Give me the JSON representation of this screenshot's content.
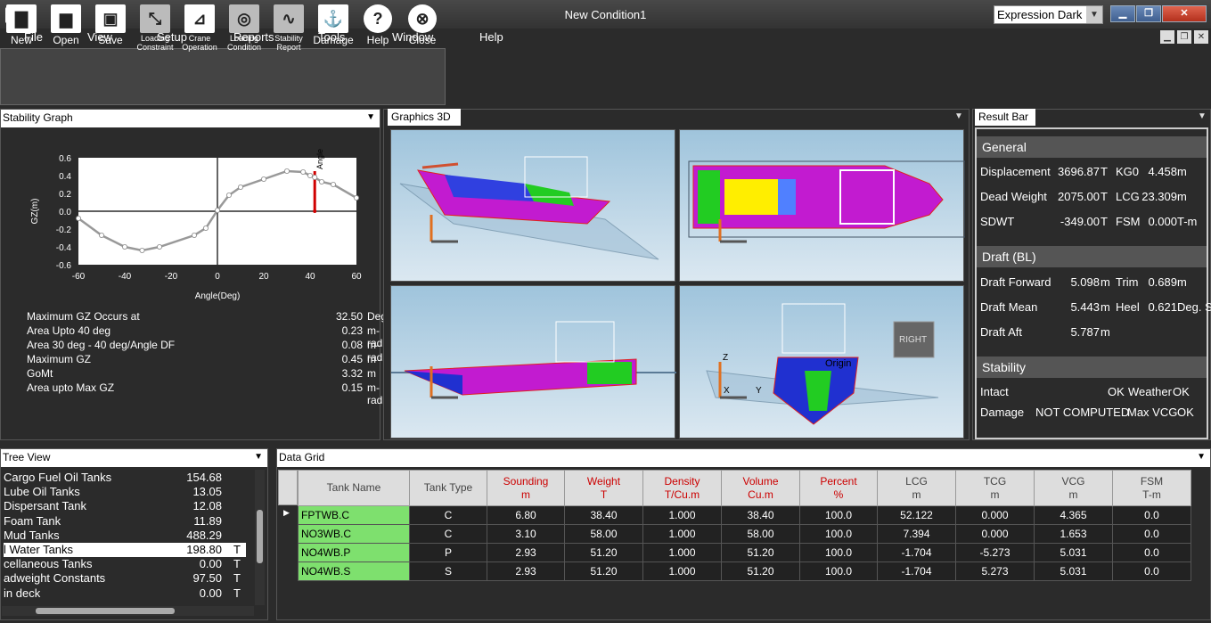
{
  "title": "New Condition1",
  "theme": "Expression Dark",
  "window_buttons": {
    "minimize": "▁",
    "restore": "❐",
    "close": "✕"
  },
  "menu": [
    "File",
    "View",
    "Setup",
    "Reports",
    "Tools",
    "Window",
    "Help"
  ],
  "toolbar": [
    {
      "label": "New",
      "icon": "new-icon"
    },
    {
      "label": "Open",
      "icon": "open-folder-icon"
    },
    {
      "label": "Save",
      "icon": "save-icon"
    },
    {
      "label": "Loading Constraint",
      "icon": "loading-constraint-icon"
    },
    {
      "label": "Crane Operation",
      "icon": "crane-icon"
    },
    {
      "label": "Loading Condition",
      "icon": "loading-condition-icon"
    },
    {
      "label": "Stability Report",
      "icon": "stability-report-icon"
    },
    {
      "label": "Damage",
      "icon": "damage-icon"
    },
    {
      "label": "Help",
      "icon": "help-icon"
    },
    {
      "label": "Close",
      "icon": "close-icon"
    }
  ],
  "stability_graph": {
    "header": "Stability Graph",
    "stats": [
      {
        "label": "Maximum GZ Occurs at",
        "value": "32.50",
        "unit": "Deg"
      },
      {
        "label": "Area Upto 40 deg",
        "value": "0.23",
        "unit": "m-rad"
      },
      {
        "label": "Area 30 deg - 40 deg/Angle DF",
        "value": "0.08",
        "unit": "m-rad"
      },
      {
        "label": "Maximum GZ",
        "value": "0.45",
        "unit": "m"
      },
      {
        "label": "GoMt",
        "value": "3.32",
        "unit": "m"
      },
      {
        "label": "Area upto Max GZ",
        "value": "0.15",
        "unit": "m-rad"
      }
    ]
  },
  "chart_data": {
    "type": "line",
    "xlabel": "Angle(Deg)",
    "ylabel": "GZ(m)",
    "xlim": [
      -60,
      60
    ],
    "ylim": [
      -0.6,
      0.6
    ],
    "xticks": [
      "-60",
      "-40",
      "-20",
      "0",
      "20",
      "40",
      "60"
    ],
    "yticks": [
      "0.6",
      "0.4",
      "0.2",
      "0.0",
      "-0.2",
      "-0.4",
      "-0.6"
    ],
    "x": [
      -60,
      -50,
      -40,
      -32.5,
      -25,
      -10,
      -5,
      0,
      5,
      10,
      20,
      30,
      37,
      40,
      42,
      45,
      50,
      60
    ],
    "y": [
      -0.08,
      -0.27,
      -0.4,
      -0.44,
      -0.4,
      -0.27,
      -0.19,
      0.01,
      0.18,
      0.27,
      0.36,
      0.45,
      0.44,
      0.4,
      0.38,
      0.33,
      0.3,
      0.15
    ],
    "annotation": {
      "label": "Angle DF",
      "x": 42,
      "y_from": 0.0,
      "y_to": 0.45
    }
  },
  "graphics3d": {
    "header": "Graphics 3D",
    "right_label": "RIGHT",
    "origin_label": "Origin",
    "axis_z": "Z",
    "axis_y": "Y",
    "axis_x": "X"
  },
  "result_bar": {
    "header": "Result Bar",
    "general": {
      "title": "General",
      "rows": [
        [
          "Displacement",
          "3696.87",
          "T",
          "KG0",
          "4.458",
          "m"
        ],
        [
          "Dead Weight",
          "2075.00",
          "T",
          "LCG",
          "23.309",
          "m"
        ],
        [
          "SDWT",
          "-349.00",
          "T",
          "FSM",
          "0.000",
          "T-m"
        ]
      ]
    },
    "draft": {
      "title": "Draft (BL)",
      "rows": [
        [
          "Draft Forward",
          "5.098",
          "m",
          "Trim",
          "0.689",
          "m"
        ],
        [
          "Draft Mean",
          "5.443",
          "m",
          "Heel",
          "0.621",
          "Deg. S"
        ],
        [
          "Draft Aft",
          "5.787",
          "m",
          "",
          "",
          ""
        ]
      ]
    },
    "stability": {
      "title": "Stability",
      "intact_label": "Intact",
      "intact_value": "OK",
      "weather_label": "Weather",
      "weather_value": "OK",
      "damage_label": "Damage",
      "damage_value": "NOT COMPUTED",
      "maxvcg_label": "Max VCG",
      "maxvcg_value": "OK"
    }
  },
  "tree_view": {
    "header": "Tree View",
    "items": [
      {
        "label": "Cargo Fuel Oil Tanks",
        "value": "154.68",
        "unit": ""
      },
      {
        "label": "Lube Oil Tanks",
        "value": "13.05",
        "unit": ""
      },
      {
        "label": "Dispersant Tank",
        "value": "12.08",
        "unit": ""
      },
      {
        "label": "Foam Tank",
        "value": "11.89",
        "unit": ""
      },
      {
        "label": "Mud Tanks",
        "value": "488.29",
        "unit": ""
      },
      {
        "label": "l Water Tanks",
        "value": "198.80",
        "unit": "T"
      },
      {
        "label": "cellaneous Tanks",
        "value": "0.00",
        "unit": "T"
      },
      {
        "label": "adweight Constants",
        "value": "97.50",
        "unit": "T"
      },
      {
        "label": "in deck",
        "value": "0.00",
        "unit": "T"
      }
    ],
    "selected_index": 5
  },
  "data_grid": {
    "header": "Data Grid",
    "columns": [
      {
        "l1": "Tank Name",
        "l2": "",
        "red": false
      },
      {
        "l1": "Tank Type",
        "l2": "",
        "red": false
      },
      {
        "l1": "Sounding",
        "l2": "m",
        "red": true
      },
      {
        "l1": "Weight",
        "l2": "T",
        "red": true
      },
      {
        "l1": "Density",
        "l2": "T/Cu.m",
        "red": true
      },
      {
        "l1": "Volume",
        "l2": "Cu.m",
        "red": true
      },
      {
        "l1": "Percent",
        "l2": "%",
        "red": true
      },
      {
        "l1": "LCG",
        "l2": "m",
        "red": false
      },
      {
        "l1": "TCG",
        "l2": "m",
        "red": false
      },
      {
        "l1": "VCG",
        "l2": "m",
        "red": false
      },
      {
        "l1": "FSM",
        "l2": "T-m",
        "red": false
      }
    ],
    "rows": [
      [
        "FPTWB.C",
        "C",
        "6.80",
        "38.40",
        "1.000",
        "38.40",
        "100.0",
        "52.122",
        "0.000",
        "4.365",
        "0.0"
      ],
      [
        "NO3WB.C",
        "C",
        "3.10",
        "58.00",
        "1.000",
        "58.00",
        "100.0",
        "7.394",
        "0.000",
        "1.653",
        "0.0"
      ],
      [
        "NO4WB.P",
        "P",
        "2.93",
        "51.20",
        "1.000",
        "51.20",
        "100.0",
        "-1.704",
        "-5.273",
        "5.031",
        "0.0"
      ],
      [
        "NO4WB.S",
        "S",
        "2.93",
        "51.20",
        "1.000",
        "51.20",
        "100.0",
        "-1.704",
        "5.273",
        "5.031",
        "0.0"
      ]
    ]
  }
}
